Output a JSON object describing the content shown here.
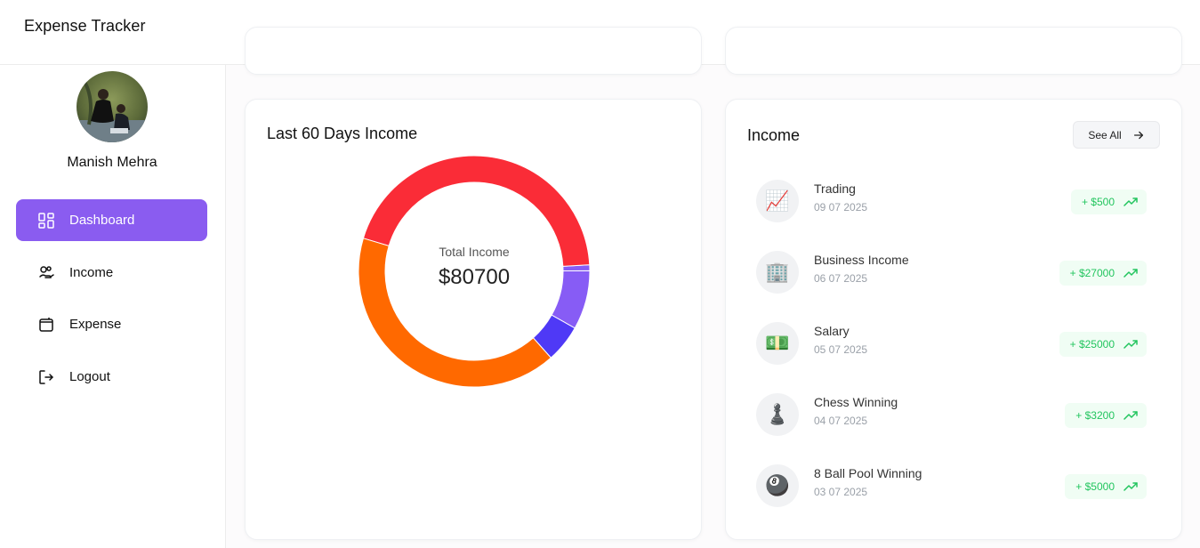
{
  "app": {
    "title": "Expense Tracker"
  },
  "user": {
    "name": "Manish Mehra"
  },
  "nav": [
    {
      "label": "Dashboard",
      "icon": "dashboard-icon",
      "active": true
    },
    {
      "label": "Income",
      "icon": "income-icon",
      "active": false
    },
    {
      "label": "Expense",
      "icon": "wallet-icon",
      "active": false
    },
    {
      "label": "Logout",
      "icon": "logout-icon",
      "active": false
    }
  ],
  "chart_card": {
    "title": "Last 60 Days Income",
    "center_label": "Total Income",
    "center_value": "$80700"
  },
  "chart_data": {
    "type": "pie",
    "title": "Last 60 Days Income",
    "total": 80700,
    "categories": [
      "Trading",
      "Business Income",
      "Salary",
      "Chess Winning",
      "8 Ball Pool Winning"
    ],
    "values": [
      500,
      27000,
      25000,
      3200,
      5000
    ],
    "colors": [
      "#875cf5",
      "#fa2c37",
      "#ff6900",
      "#4f39f6",
      "#875cf5"
    ]
  },
  "income_card": {
    "title": "Income",
    "see_all_label": "See All",
    "transactions": [
      {
        "name": "Trading",
        "date": "09 07 2025",
        "amount": "+ $500",
        "emoji": "📈"
      },
      {
        "name": "Business Income",
        "date": "06 07 2025",
        "amount": "+ $27000",
        "emoji": "🏢"
      },
      {
        "name": "Salary",
        "date": "05 07 2025",
        "amount": "+ $25000",
        "emoji": "💵"
      },
      {
        "name": "Chess Winning",
        "date": "04 07 2025",
        "amount": "+ $3200",
        "emoji": "♟️"
      },
      {
        "name": "8 Ball Pool Winning",
        "date": "03 07 2025",
        "amount": "+ $5000",
        "emoji": "🎱"
      }
    ]
  },
  "colors": {
    "accent": "#8a5cf0",
    "income_green": "#22c55e",
    "income_badge_bg": "#f0fdf4"
  }
}
